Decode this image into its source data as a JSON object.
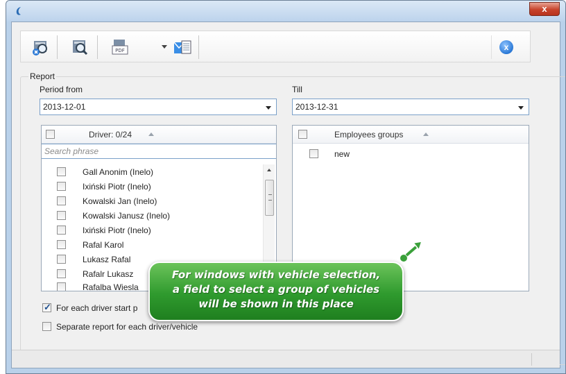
{
  "window": {
    "close_glyph": "x"
  },
  "toolbar": {
    "buttons": [
      {
        "icon": "report-delete-icon"
      },
      {
        "icon": "report-preview-icon"
      },
      {
        "icon": "pdf-export-icon"
      },
      {
        "icon": "send-report-icon"
      }
    ],
    "close_glyph": "x"
  },
  "report": {
    "caption": "Report",
    "period_from_label": "Period from",
    "period_from_value": "2013-12-01",
    "till_label": "Till",
    "till_value": "2013-12-31"
  },
  "drivers": {
    "header": "Driver: 0/24",
    "search_placeholder": "Search phrase",
    "items": [
      "Gall Anonim (Inelo)",
      "Ixiński Piotr (Inelo)",
      "Kowalski Jan (Inelo)",
      "Kowalski Janusz (Inelo)",
      "Ixiński Piotr (Inelo)",
      "Rafal Karol",
      "Lukasz  Rafal",
      "Rafalr Lukasz",
      "Rafalba Wiesla"
    ]
  },
  "groups": {
    "header": "Employees groups",
    "items": [
      "new"
    ]
  },
  "options": {
    "each_driver_label": "For each driver start p",
    "each_driver_checked": true,
    "separate_label": "Separate report for each driver/vehicle",
    "separate_checked": false
  },
  "tooltip": {
    "line1": "For windows with vehicle selection,",
    "line2": "a field to select a group of vehicles",
    "line3": "will be shown in this place"
  }
}
